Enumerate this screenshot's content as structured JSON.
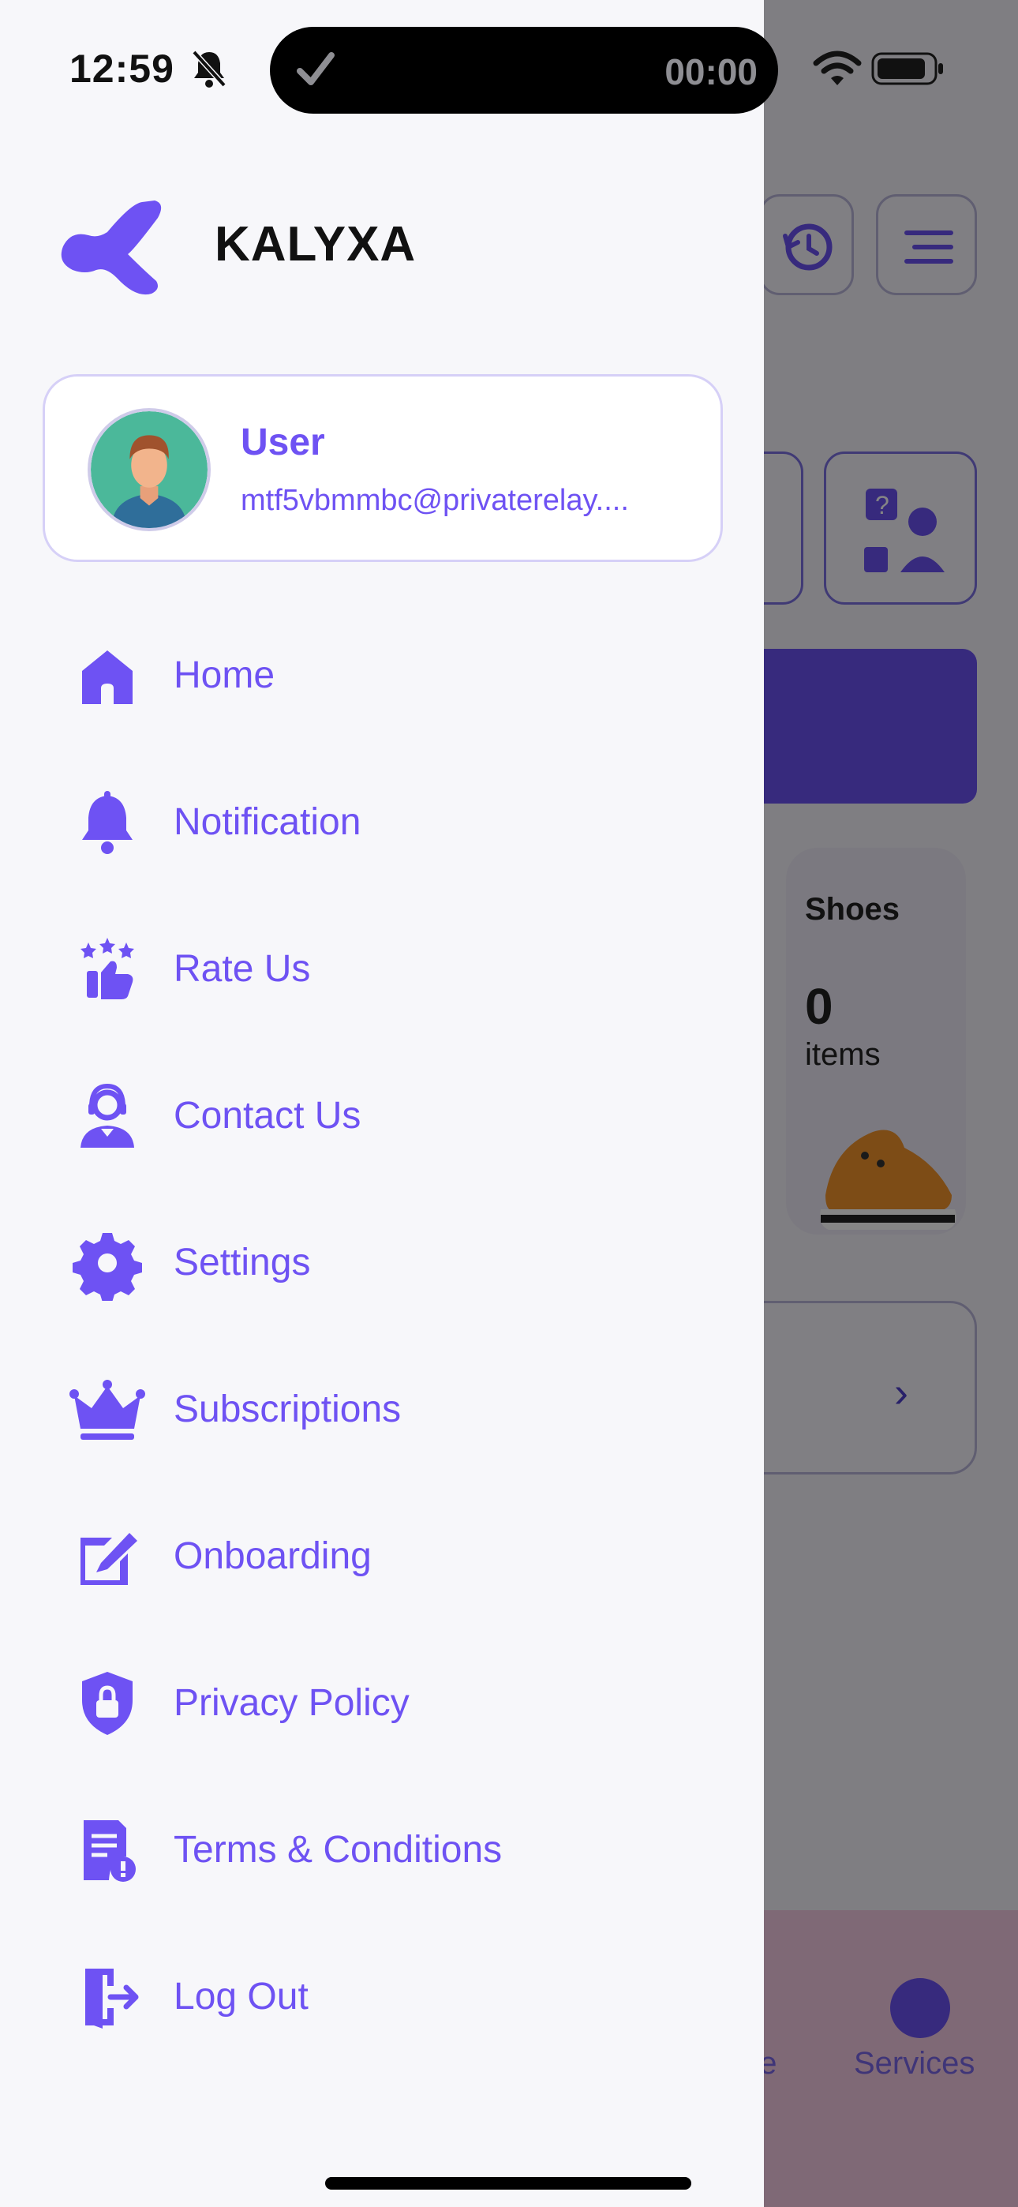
{
  "status_bar": {
    "time": "12:59",
    "live_activity_timer": "00:00"
  },
  "brand": {
    "name": "KALYXA",
    "accent_color": "#6e52f3"
  },
  "profile": {
    "name": "User",
    "email": "mtf5vbmmbc@privaterelay...."
  },
  "menu": {
    "items": [
      {
        "label": "Home",
        "icon": "home-icon"
      },
      {
        "label": "Notification",
        "icon": "bell-icon"
      },
      {
        "label": "Rate Us",
        "icon": "rate-thumbs-up-icon"
      },
      {
        "label": "Contact Us",
        "icon": "support-agent-icon"
      },
      {
        "label": "Settings",
        "icon": "gear-icon"
      },
      {
        "label": "Subscriptions",
        "icon": "crown-icon"
      },
      {
        "label": "Onboarding",
        "icon": "edit-icon"
      },
      {
        "label": "Privacy Policy",
        "icon": "shield-lock-icon"
      },
      {
        "label": "Terms & Conditions",
        "icon": "document-alert-icon"
      },
      {
        "label": "Log Out",
        "icon": "logout-icon"
      }
    ]
  },
  "background": {
    "shoes_card": {
      "title": "Shoes",
      "count": "0",
      "unit": "items"
    },
    "tab_partial_label": "ge",
    "tab_services_label": "Services"
  }
}
